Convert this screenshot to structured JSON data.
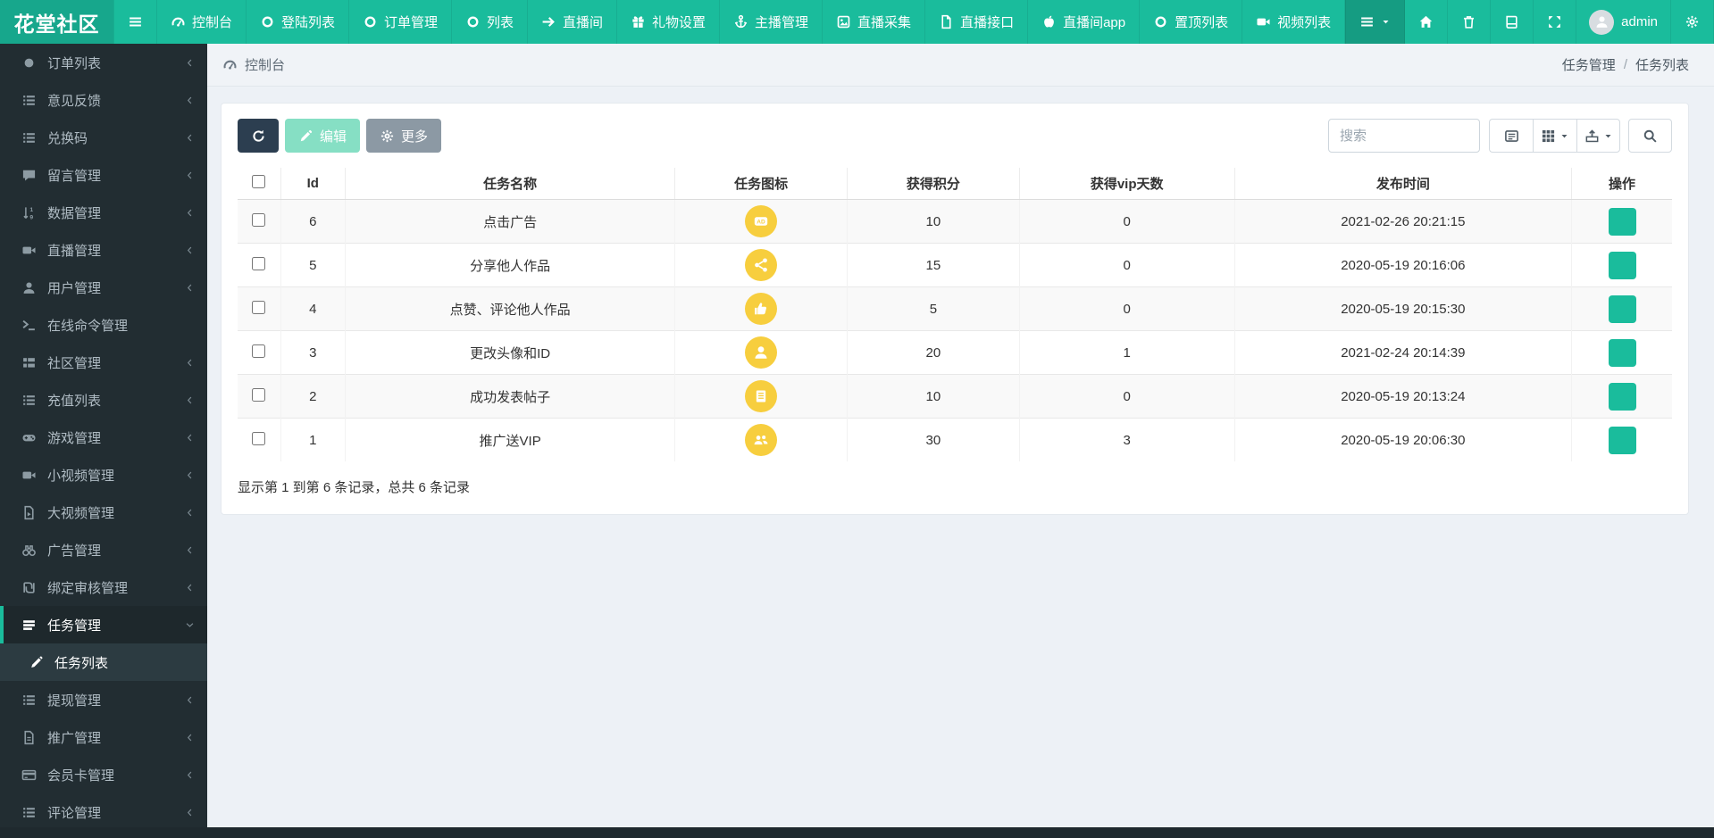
{
  "colors": {
    "accent": "#1abc9c",
    "navbar": "#1abc9c",
    "brand_bg": "#17a78c",
    "navbar_active": "#159c82",
    "sidebar_bg": "#222d32",
    "sidebar_text": "#b0bcc4",
    "sidebar_active_bg": "#1e282c",
    "sidebar_child_bg": "#2c3b41",
    "content_bg": "#edf1f6",
    "header_bar_bg": "#f0f3f7",
    "card_bg": "#ffffff",
    "dark_btn": "#2c3e50",
    "edit_btn": "#86dfc4",
    "more_btn": "#8c99a4",
    "icon_yellow": "#f7ce3e",
    "edit_action": "#1abc9c",
    "stripe": "#f9f9f9"
  },
  "brand": "花堂社区",
  "navbar": {
    "items": [
      {
        "icon": "bars",
        "label": ""
      },
      {
        "icon": "gauge",
        "label": "控制台"
      },
      {
        "icon": "circle-o",
        "label": "登陆列表"
      },
      {
        "icon": "circle-o",
        "label": "订单管理"
      },
      {
        "icon": "circle-o",
        "label": "列表"
      },
      {
        "icon": "arrow-right",
        "label": "直播间"
      },
      {
        "icon": "gift",
        "label": "礼物设置"
      },
      {
        "icon": "anchor",
        "label": "主播管理"
      },
      {
        "icon": "collect",
        "label": "直播采集"
      },
      {
        "icon": "file",
        "label": "直播接口"
      },
      {
        "icon": "apple",
        "label": "直播间app"
      },
      {
        "icon": "circle-o",
        "label": "置顶列表"
      },
      {
        "icon": "video",
        "label": "视频列表"
      }
    ],
    "right_items": [
      {
        "icon": "bars",
        "caret": true,
        "active": true,
        "name": "menu-dropdown"
      },
      {
        "icon": "home",
        "name": "home"
      },
      {
        "icon": "trash",
        "name": "trash"
      },
      {
        "icon": "book",
        "name": "book"
      },
      {
        "icon": "expand",
        "name": "fullscreen"
      },
      {
        "user": true,
        "label": "admin",
        "name": "user-menu"
      },
      {
        "icon": "cogs",
        "name": "settings"
      }
    ]
  },
  "sidebar": {
    "items": [
      {
        "icon": "circle",
        "label": "订单列表",
        "chevron": "left"
      },
      {
        "icon": "list",
        "label": "意见反馈",
        "chevron": "left"
      },
      {
        "icon": "list",
        "label": "兑换码",
        "chevron": "left"
      },
      {
        "icon": "comment",
        "label": "留言管理",
        "chevron": "left"
      },
      {
        "icon": "sort-numeric",
        "label": "数据管理",
        "chevron": "left"
      },
      {
        "icon": "video",
        "label": "直播管理",
        "chevron": "left"
      },
      {
        "icon": "user",
        "label": "用户管理",
        "chevron": "left"
      },
      {
        "icon": "terminal",
        "label": "在线命令管理",
        "chevron": "none"
      },
      {
        "icon": "th-list",
        "label": "社区管理",
        "chevron": "left"
      },
      {
        "icon": "list",
        "label": "充值列表",
        "chevron": "left"
      },
      {
        "icon": "gamepad",
        "label": "游戏管理",
        "chevron": "left"
      },
      {
        "icon": "video",
        "label": "小视频管理",
        "chevron": "left"
      },
      {
        "icon": "file-video",
        "label": "大视频管理",
        "chevron": "left"
      },
      {
        "icon": "binoculars",
        "label": "广告管理",
        "chevron": "left"
      },
      {
        "icon": "shekel",
        "label": "绑定审核管理",
        "chevron": "left"
      },
      {
        "icon": "tasks",
        "label": "任务管理",
        "chevron": "down",
        "active": true
      },
      {
        "icon": "pen",
        "label": "任务列表",
        "chevron": "none",
        "child": true
      },
      {
        "icon": "list",
        "label": "提现管理",
        "chevron": "left"
      },
      {
        "icon": "file-text",
        "label": "推广管理",
        "chevron": "left"
      },
      {
        "icon": "credit-card",
        "label": "会员卡管理",
        "chevron": "left"
      },
      {
        "icon": "list",
        "label": "评论管理",
        "chevron": "left"
      }
    ]
  },
  "breadcrumb": {
    "left_label": "控制台",
    "right_parent": "任务管理",
    "separator": "/",
    "right_current": "任务列表"
  },
  "toolbar": {
    "edit_label": "编辑",
    "more_label": "更多",
    "search_placeholder": "搜索"
  },
  "table": {
    "headers": [
      "Id",
      "任务名称",
      "任务图标",
      "获得积分",
      "获得vip天数",
      "发布时间",
      "操作"
    ],
    "rows": [
      {
        "id": "6",
        "name": "点击广告",
        "icon": "ad",
        "points": "10",
        "vip_days": "0",
        "time": "2021-02-26 20:21:15"
      },
      {
        "id": "5",
        "name": "分享他人作品",
        "icon": "share",
        "points": "15",
        "vip_days": "0",
        "time": "2020-05-19 20:16:06"
      },
      {
        "id": "4",
        "name": "点赞、评论他人作品",
        "icon": "thumbs-up",
        "points": "5",
        "vip_days": "0",
        "time": "2020-05-19 20:15:30"
      },
      {
        "id": "3",
        "name": "更改头像和ID",
        "icon": "user-solid",
        "points": "20",
        "vip_days": "1",
        "time": "2021-02-24 20:14:39"
      },
      {
        "id": "2",
        "name": "成功发表帖子",
        "icon": "list-doc",
        "points": "10",
        "vip_days": "0",
        "time": "2020-05-19 20:13:24"
      },
      {
        "id": "1",
        "name": "推广送VIP",
        "icon": "users",
        "points": "30",
        "vip_days": "3",
        "time": "2020-05-19 20:06:30"
      }
    ],
    "summary": "显示第 1 到第 6 条记录，总共 6 条记录"
  }
}
